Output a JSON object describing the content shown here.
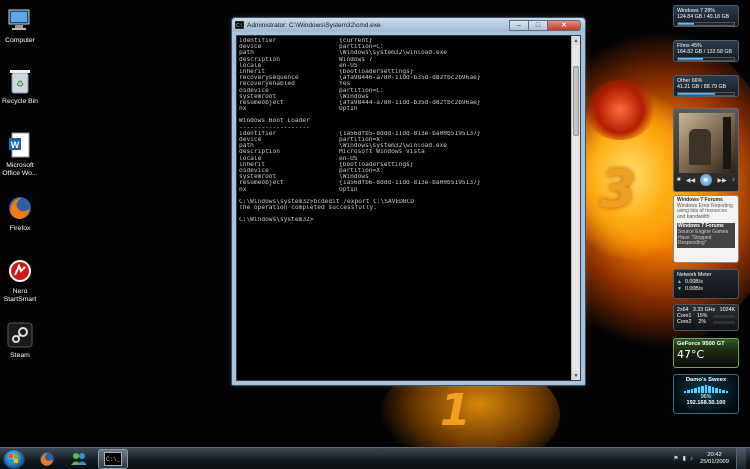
{
  "desktop": {
    "icons": [
      {
        "label": "Computer"
      },
      {
        "label": "Recycle Bin"
      },
      {
        "label": "Microsoft Office Wo..."
      },
      {
        "label": "Firefox"
      },
      {
        "label": "Nero StartSmart"
      },
      {
        "label": "Steam"
      }
    ],
    "wallpaper_numbers": [
      "3",
      "1"
    ]
  },
  "cmd": {
    "title": "Administrator: C:\\Windows\\System32\\cmd.exe",
    "lines": [
      {
        "k": "identifier",
        "v": "{current}"
      },
      {
        "k": "device",
        "v": "partition=C:"
      },
      {
        "k": "path",
        "v": "\\Windows\\system32\\winload.exe"
      },
      {
        "k": "description",
        "v": "Windows 7"
      },
      {
        "k": "locale",
        "v": "en-US"
      },
      {
        "k": "inherit",
        "v": "{bootloadersettings}"
      },
      {
        "k": "recoverysequence",
        "v": "{afa98446-a780-11dd-b35d-d82fbc2b96ae}"
      },
      {
        "k": "recoveryenabled",
        "v": "Yes"
      },
      {
        "k": "osdevice",
        "v": "partition=C:"
      },
      {
        "k": "systemroot",
        "v": "\\Windows"
      },
      {
        "k": "resumeobject",
        "v": "{afa98444-a780-11dd-b35d-d82fbc2b96ae}"
      },
      {
        "k": "nx",
        "v": "OptIn"
      },
      {
        "k": "",
        "v": ""
      },
      {
        "k": "Windows Boot Loader",
        "v": ""
      },
      {
        "k": "-------------------",
        "v": ""
      },
      {
        "k": "identifier",
        "v": "{1a56dfb5-8ddd-11dd-813e-ba00b5195137}"
      },
      {
        "k": "device",
        "v": "partition=X:"
      },
      {
        "k": "path",
        "v": "\\Windows\\system32\\winload.exe"
      },
      {
        "k": "description",
        "v": "Microsoft Windows Vista"
      },
      {
        "k": "locale",
        "v": "en-US"
      },
      {
        "k": "inherit",
        "v": "{bootloadersettings}"
      },
      {
        "k": "osdevice",
        "v": "partition=X:"
      },
      {
        "k": "systemroot",
        "v": "\\Windows"
      },
      {
        "k": "resumeobject",
        "v": "{1a56dfb6-8ddd-11dd-813e-ba00b5195137}"
      },
      {
        "k": "nx",
        "v": "OptIn"
      },
      {
        "k": "",
        "v": ""
      },
      {
        "k": "C:\\Windows\\system32>bcdedit /export C:\\SAVEDBCD",
        "v": ""
      },
      {
        "k": "The operation completed successfully.",
        "v": ""
      },
      {
        "k": "",
        "v": ""
      },
      {
        "k": "C:\\Windows\\system32>",
        "v": ""
      }
    ]
  },
  "gadgets": {
    "drives": [
      {
        "name": "Windows 7",
        "pct": "28%",
        "usage": "124.84 GB / 40.18 GB",
        "fill": 0.28
      },
      {
        "name": "Films",
        "pct": "45%",
        "usage": "164.82 GB / 132.58 GB",
        "fill": 0.45
      },
      {
        "name": "Other",
        "pct": "66%",
        "usage": "41.21 GB / 88.79 GB",
        "fill": 0.66
      }
    ],
    "feed": [
      {
        "title": "Windows 7 Forums",
        "body": "Windows Error Reporting using lots of resources and bandwidth"
      },
      {
        "title": "Windows 7 Forums",
        "body": "Source Engine Games Have \"Stopped Responding\""
      }
    ],
    "network": {
      "title": "Network Meter",
      "up": "0.00B/s",
      "down": "0.00B/s"
    },
    "cpu": {
      "cores": "2x64",
      "speed": "3.33 GHz",
      "ram": "1024K",
      "core1_label": "Core1",
      "core1": "15%",
      "core2_label": "Core2",
      "core2": "2%"
    },
    "gpu": {
      "name": "GeForce 9500 GT",
      "temp": "47°C"
    },
    "wifi": {
      "name": "Damo's Sweex",
      "signal": "96%",
      "ip": "192.168.50.100"
    }
  },
  "taskbar": {
    "time": "20:42",
    "date": "25/01/2009"
  }
}
